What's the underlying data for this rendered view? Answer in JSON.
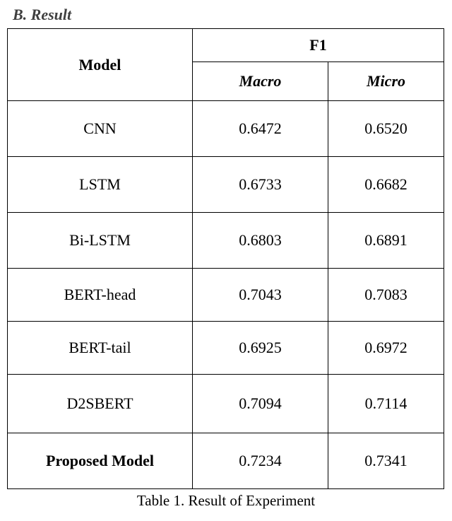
{
  "section_heading": "B.   Result",
  "chart_data": {
    "type": "table",
    "title": "Table 1. Result of Experiment",
    "columns": {
      "model": "Model",
      "f1": "F1",
      "macro": "Macro",
      "micro": "Micro"
    },
    "groups": [
      {
        "rows": [
          {
            "model": "CNN",
            "macro": "0.6472",
            "micro": "0.6520"
          },
          {
            "model": "LSTM",
            "macro": "0.6733",
            "micro": "0.6682"
          },
          {
            "model": "Bi-LSTM",
            "macro": "0.6803",
            "micro": "0.6891"
          }
        ]
      },
      {
        "rows": [
          {
            "model": "BERT-head",
            "macro": "0.7043",
            "micro": "0.7083"
          },
          {
            "model": "BERT-tail",
            "macro": "0.6925",
            "micro": "0.6972"
          }
        ]
      },
      {
        "rows": [
          {
            "model": "D2SBERT",
            "macro": "0.7094",
            "micro": "0.7114"
          }
        ]
      },
      {
        "rows": [
          {
            "model": "Proposed Model",
            "macro": "0.7234",
            "micro": "0.7341",
            "bold_model": true
          }
        ]
      }
    ]
  }
}
